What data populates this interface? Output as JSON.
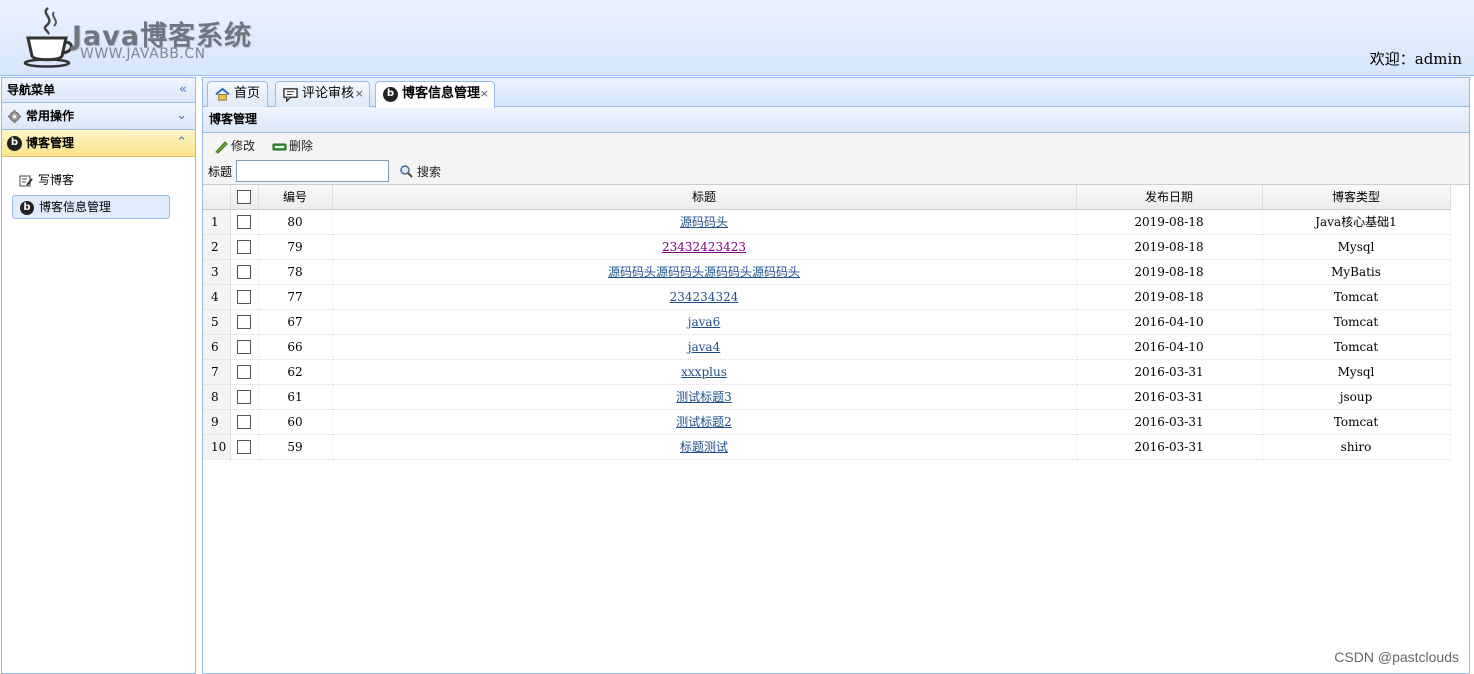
{
  "header": {
    "logo_title": "Java博客系统",
    "logo_url": "WWW.JAVABB.CN",
    "welcome": "欢迎：admin"
  },
  "nav": {
    "title": "导航菜单",
    "collapse_icon": "double-chevron-left-icon",
    "sections": [
      {
        "label": "常用操作",
        "icon": "gear-icon",
        "state": "collapsed"
      },
      {
        "label": "博客管理",
        "icon": "blog-icon",
        "state": "expanded"
      }
    ],
    "items": [
      {
        "label": "写博客",
        "icon": "edit-icon"
      },
      {
        "label": "博客信息管理",
        "icon": "blog-icon",
        "selected": true
      }
    ]
  },
  "tabs": [
    {
      "label": "首页",
      "icon": "home-icon",
      "closable": false
    },
    {
      "label": "评论审核",
      "icon": "comment-icon",
      "closable": true
    },
    {
      "label": "博客信息管理",
      "icon": "blog-icon",
      "closable": true,
      "active": true
    }
  ],
  "panel": {
    "title": "博客管理",
    "edit_label": "修改",
    "delete_label": "删除",
    "search_label": "标题",
    "search_value": "",
    "search_button": "搜索"
  },
  "grid": {
    "columns": {
      "id": "编号",
      "title": "标题",
      "date": "发布日期",
      "type": "博客类型"
    },
    "rows": [
      {
        "num": "1",
        "id": "80",
        "title": "源码码头",
        "date": "2019-08-18",
        "type": "Java核心基础1",
        "visited": false
      },
      {
        "num": "2",
        "id": "79",
        "title": "23432423423",
        "date": "2019-08-18",
        "type": "Mysql",
        "visited": true
      },
      {
        "num": "3",
        "id": "78",
        "title": "源码码头源码码头源码码头源码码头",
        "date": "2019-08-18",
        "type": "MyBatis",
        "visited": false
      },
      {
        "num": "4",
        "id": "77",
        "title": "234234324",
        "date": "2019-08-18",
        "type": "Tomcat",
        "visited": false
      },
      {
        "num": "5",
        "id": "67",
        "title": "java6",
        "date": "2016-04-10",
        "type": "Tomcat",
        "visited": false
      },
      {
        "num": "6",
        "id": "66",
        "title": "java4",
        "date": "2016-04-10",
        "type": "Tomcat",
        "visited": false
      },
      {
        "num": "7",
        "id": "62",
        "title": "xxxplus",
        "date": "2016-03-31",
        "type": "Mysql",
        "visited": false
      },
      {
        "num": "8",
        "id": "61",
        "title": "测试标题3",
        "date": "2016-03-31",
        "type": "jsoup",
        "visited": false
      },
      {
        "num": "9",
        "id": "60",
        "title": "测试标题2",
        "date": "2016-03-31",
        "type": "Tomcat",
        "visited": false
      },
      {
        "num": "10",
        "id": "59",
        "title": "标题测试",
        "date": "2016-03-31",
        "type": "shiro",
        "visited": false
      }
    ]
  },
  "watermark": "CSDN @pastclouds",
  "colors": {
    "border": "#99bbe8",
    "active_section": "#fbe38a",
    "link": "#1f4f8a",
    "visited_link": "#800080"
  }
}
